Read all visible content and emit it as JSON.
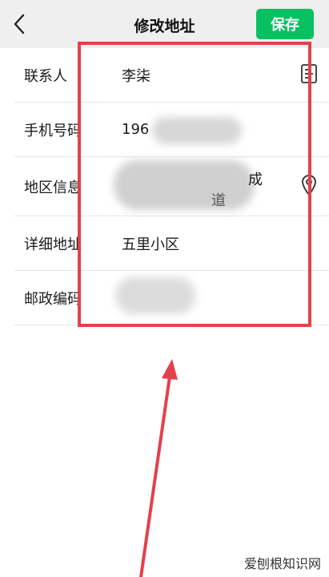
{
  "header": {
    "title": "修改地址",
    "save_label": "保存"
  },
  "form": {
    "contact": {
      "label": "联系人",
      "value": "李柒"
    },
    "phone": {
      "label": "手机号码",
      "value": "196"
    },
    "region": {
      "label": "地区信息",
      "value_line1": "成",
      "value_line2": "道"
    },
    "detail": {
      "label": "详细地址",
      "value": "五里小区"
    },
    "postal": {
      "label": "邮政编码",
      "value": ""
    }
  },
  "watermark": "爱刨根知识网",
  "colors": {
    "save_button": "#07c160",
    "header_bg": "#efefef",
    "annotation": "#e3414c"
  },
  "icons": {
    "back": "chevron-left-icon",
    "contact_book": "contact-book-icon",
    "location": "location-pin-icon"
  }
}
